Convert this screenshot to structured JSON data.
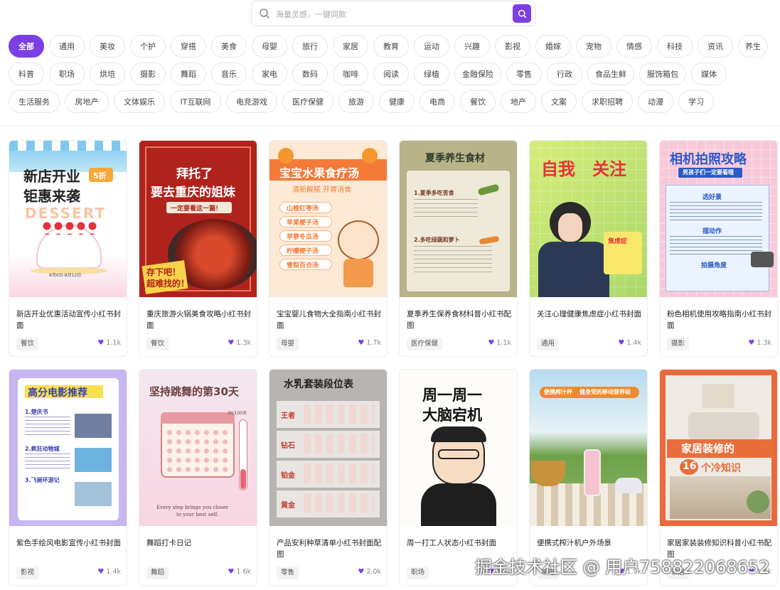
{
  "search": {
    "placeholder": "海量灵感，一键同款"
  },
  "tag_rows": [
    [
      "全部",
      "通用",
      "美妆",
      "个护",
      "穿搭",
      "美食",
      "母婴",
      "旅行",
      "家居",
      "教育",
      "运动",
      "兴趣",
      "影视",
      "婚嫁",
      "宠物",
      "情感",
      "科技",
      "资讯",
      "养生"
    ],
    [
      "科普",
      "职场",
      "烘培",
      "摄影",
      "舞蹈",
      "音乐",
      "家电",
      "数码",
      "咖啡",
      "阅读",
      "绿植",
      "金融保险",
      "零售",
      "行政",
      "食品生鲜",
      "服饰箱包",
      "媒体"
    ],
    [
      "生活服务",
      "房地产",
      "文体娱乐",
      "IT互联网",
      "电竞游戏",
      "医疗保健",
      "旅游",
      "健康",
      "电商",
      "餐饮",
      "地产",
      "文案",
      "求职招聘",
      "动漫",
      "学习"
    ]
  ],
  "active_tag": "全部",
  "cards": [
    {
      "title": "新店开业优惠活动宣传小红书封面",
      "tag": "餐饮",
      "likes": "1.1k",
      "thumb_text": [
        "新店开业",
        "钜惠来袭",
        "5折",
        "DESSERT",
        "8月6日-8月12日"
      ]
    },
    {
      "title": "重庆旅游火锅美食攻略小红书封面",
      "tag": "餐饮",
      "likes": "1.3k",
      "thumb_text": [
        "拜托了",
        "要去重庆的姐妹",
        "一定要看这一篇！",
        "存下吧！",
        "超难找的！"
      ]
    },
    {
      "title": "宝宝婴儿食物大全指南小红书封面",
      "tag": "母婴",
      "likes": "1.7k",
      "thumb_text": [
        "宝宝水果食疗汤",
        "清新解腻 开胃消食",
        "山楂红枣汤",
        "苹果梗子汤",
        "苹萝冬瓜汤",
        "柠檬梗子汤",
        "雪梨百合汤"
      ]
    },
    {
      "title": "夏季养生保养食材科普小红书配图",
      "tag": "医疗保健",
      "likes": "1.1k",
      "thumb_text": [
        "夏季养生食材",
        "1.夏季多吃苦食",
        "2.多吃绿蔬和萝卜"
      ]
    },
    {
      "title": "关注心理健康焦虑症小红书封面",
      "tag": "通用",
      "likes": "1.4k",
      "thumb_text": [
        "自我",
        "关注",
        "焦虑症"
      ]
    },
    {
      "title": "粉色相机使用攻略指南小红书封面",
      "tag": "摄影",
      "likes": "1.3k",
      "thumb_text": [
        "相机拍照攻略",
        "男孩子们一定要看哦",
        "选好景",
        "摆动作",
        "拍摄角度"
      ]
    },
    {
      "title": "紫色手绘风电影宣传小红书封面",
      "tag": "影视",
      "likes": "1.4k",
      "thumb_text": [
        "高分电影推荐",
        "1.楚庆书",
        "2.疯狂动物城",
        "3.飞屋环游记"
      ]
    },
    {
      "title": "舞蹈打卡日记",
      "tag": "舞蹈",
      "likes": "1.6k",
      "thumb_text": [
        "坚持跳舞的第30天",
        "30/100天",
        "Every step brings you closer",
        "to your best self."
      ]
    },
    {
      "title": "产品安利种草清单小红书封面配图",
      "tag": "零售",
      "likes": "2.0k",
      "thumb_text": [
        "水乳套装段位表",
        "王者",
        "钻石",
        "铂金",
        "黄金"
      ]
    },
    {
      "title": "周一打工人状态小红书封面",
      "tag": "职场",
      "likes": "1.5k",
      "thumb_text": [
        "周一周一",
        "大脑宕机"
      ]
    },
    {
      "title": "便携式榨汁机户外场景",
      "tag": "家电",
      "likes": "1.9k",
      "thumb_text": [
        "便携榨汁杯",
        "健身党的移动营养站"
      ]
    },
    {
      "title": "家居家装装修知识科普小红书配图",
      "tag": "家居",
      "likes": "1.1k",
      "thumb_text": [
        "家居装修的",
        "16",
        "个冷知识"
      ]
    }
  ],
  "watermark": "掘金技术社区 @ 用户758822068652",
  "colors": {
    "accent": "#7b3fe4",
    "tag_border": "#e6e6eb",
    "heart": "#7b3fe4"
  },
  "icons": {
    "search": "search-icon",
    "search_button": "search-icon",
    "like": "heart-icon"
  }
}
